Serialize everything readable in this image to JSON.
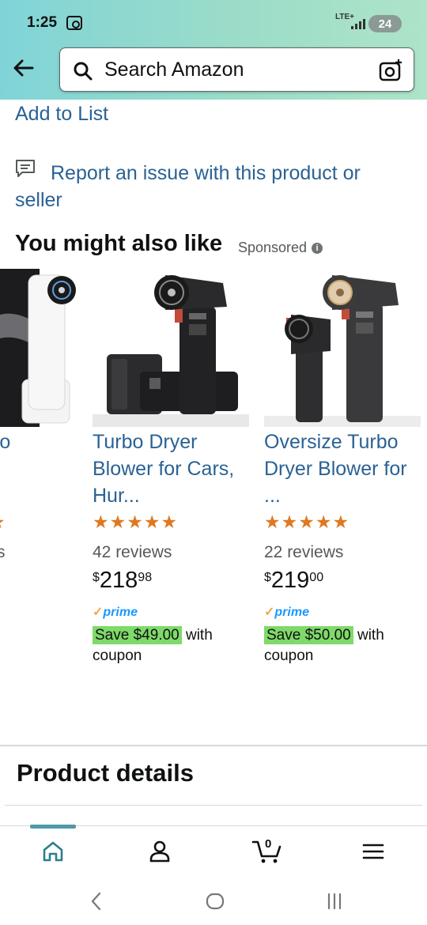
{
  "status_bar": {
    "time": "1:25",
    "network": "LTE+",
    "battery": "24"
  },
  "search": {
    "placeholder": "Search Amazon"
  },
  "links": {
    "add_to_list": "Add to List",
    "report": "Report an issue with this product or seller"
  },
  "recommendations": {
    "title": "You might also like",
    "sponsored": "Sponsored",
    "items": [
      {
        "title": "r Air Turbo",
        "reviews": "s"
      },
      {
        "title": "Turbo Dryer Blower for Cars, Hur...",
        "rating": 5,
        "reviews": "42 reviews",
        "price_symbol": "$",
        "price_whole": "218",
        "price_fraction": "98",
        "prime": "prime",
        "coupon_badge": "Save $49.00",
        "coupon_text": "with coupon"
      },
      {
        "title": "Oversize Turbo Dryer Blower for ...",
        "rating": 5,
        "reviews": "22 reviews",
        "price_symbol": "$",
        "price_whole": "219",
        "price_fraction": "00",
        "prime": "prime",
        "coupon_badge": "Save $50.00",
        "coupon_text": "with coupon"
      }
    ]
  },
  "product_details": {
    "title": "Product details"
  },
  "bottom_nav": {
    "cart_count": "0",
    "items": [
      "home-icon",
      "account-icon",
      "cart-icon",
      "menu-icon"
    ]
  },
  "colors": {
    "link": "#2a6294",
    "star": "#de7921",
    "coupon": "#7fda69",
    "prime": "#1a98ff",
    "header_start": "#80d4d8",
    "header_end": "#aee4c8"
  }
}
